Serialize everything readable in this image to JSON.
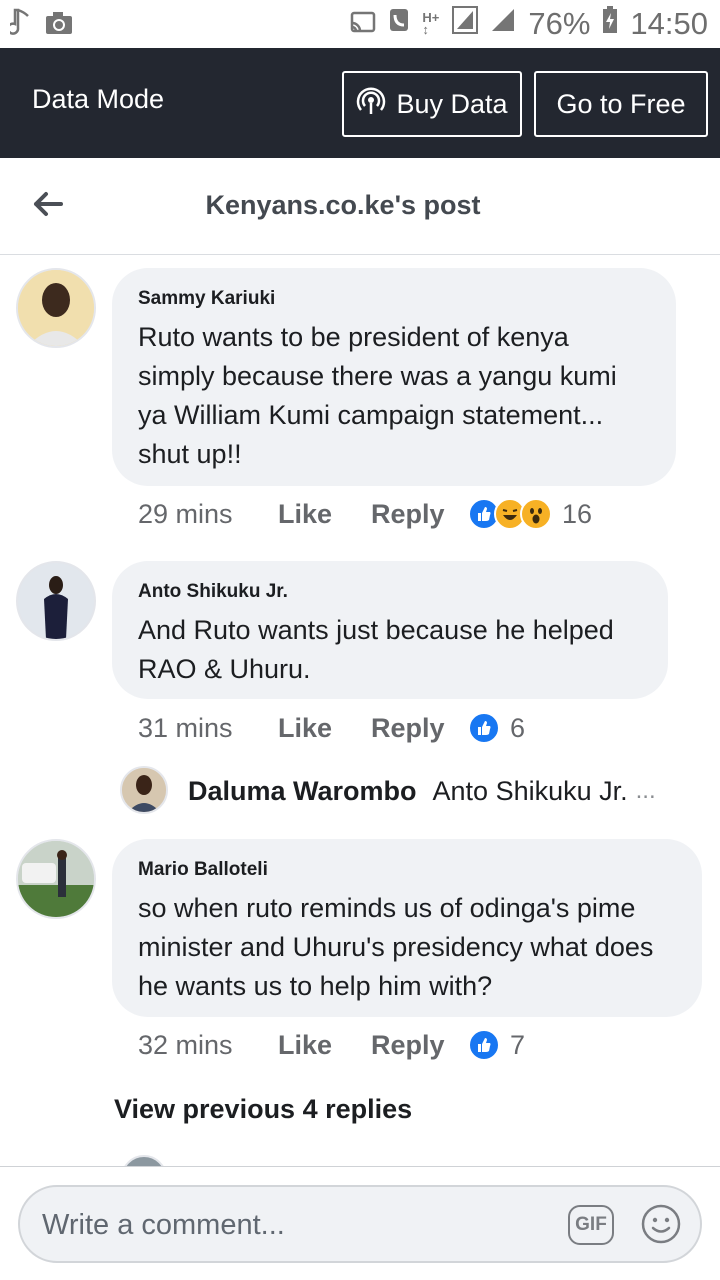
{
  "status_bar": {
    "network": "H+",
    "battery": "76%",
    "time": "14:50"
  },
  "data_bar": {
    "title": "Data Mode",
    "buy_label": "Buy Data",
    "free_label": "Go to Free"
  },
  "header": {
    "title": "Kenyans.co.ke's post"
  },
  "comments": [
    {
      "author": "Sammy Kariuki",
      "text": "Ruto wants to be president of kenya simply because there was a yangu kumi ya William Kumi campaign statement... shut up!!",
      "time": "29 mins",
      "like": "Like",
      "reply": "Reply",
      "reactions": [
        "like",
        "haha",
        "wow"
      ],
      "count": "16"
    },
    {
      "author": "Anto Shikuku Jr.",
      "text": "And Ruto wants just because he helped RAO & Uhuru.",
      "time": "31 mins",
      "like": "Like",
      "reply": "Reply",
      "reactions": [
        "like"
      ],
      "count": "6"
    },
    {
      "author": "Mario Balloteli",
      "text": "so when ruto reminds us of odinga's pime minister and Uhuru's presidency what does he wants us to help him with?",
      "time": "32 mins",
      "like": "Like",
      "reply": "Reply",
      "reactions": [
        "like"
      ],
      "count": "7"
    }
  ],
  "reply_preview": {
    "name": "Daluma Warombo",
    "snippet": "Anto Shikuku Jr.",
    "ellipsis": "..."
  },
  "view_previous": "View previous 4 replies",
  "composer": {
    "placeholder": "Write a comment...",
    "gif_label": "GIF"
  },
  "colors": {
    "data_bar_bg": "#232730",
    "bubble_bg": "#f0f2f5",
    "like_blue": "#1877f2",
    "reaction_yellow": "#f7b125"
  }
}
